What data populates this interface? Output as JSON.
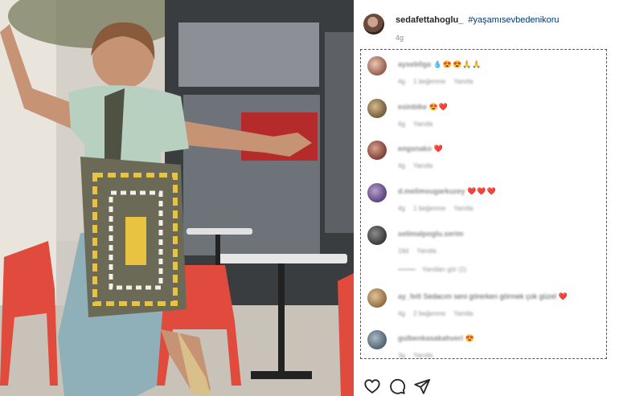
{
  "photo": {
    "description_icon": "photo-icon"
  },
  "post": {
    "username": "sedafettahoglu_",
    "hashtag": "#yaşamısevbedenikoru",
    "age": "4g"
  },
  "comments": [
    {
      "user": "ayseb0ga",
      "text": "💧😍😍🙏🙏",
      "blurred_text": false,
      "meta": [
        "4g",
        "1 beğenme",
        "Yanıtla"
      ]
    },
    {
      "user": "esinbike",
      "text": "😍❤️",
      "blurred_text": false,
      "meta": [
        "4g",
        "Yanıtla"
      ]
    },
    {
      "user": "engsnako",
      "text": "❤️",
      "blurred_text": false,
      "meta": [
        "4g",
        "Yanıtla"
      ]
    },
    {
      "user": "d.melimsugarkuzey",
      "text": "❤️❤️❤️",
      "blurred_text": false,
      "meta": [
        "4g",
        "1 beğenme",
        "Yanıtla"
      ]
    },
    {
      "user": "selimalpoglu.serim",
      "text": "",
      "blurred_text": false,
      "meta": [
        "16d",
        "Yanıtla"
      ]
    },
    {
      "user": "ay_fett",
      "text": "Sedacım seni görerken görmek çok güzel",
      "blurred_text": true,
      "emoji": "❤️",
      "meta": [
        "4g",
        "2 beğenme",
        "Yanıtla"
      ]
    },
    {
      "user": "gulbenkasakahveri",
      "text": "😍",
      "blurred_text": false,
      "meta": [
        "3g",
        "Yanıtla"
      ]
    }
  ],
  "replies_link": "Yanıtları gör (1)",
  "actions": {
    "like_icon": "heart-icon",
    "comment_icon": "comment-icon",
    "share_icon": "share-icon"
  },
  "colors": {
    "accent_link": "#00376b",
    "muted": "#8e8e8e",
    "heart": "#ed4956"
  }
}
